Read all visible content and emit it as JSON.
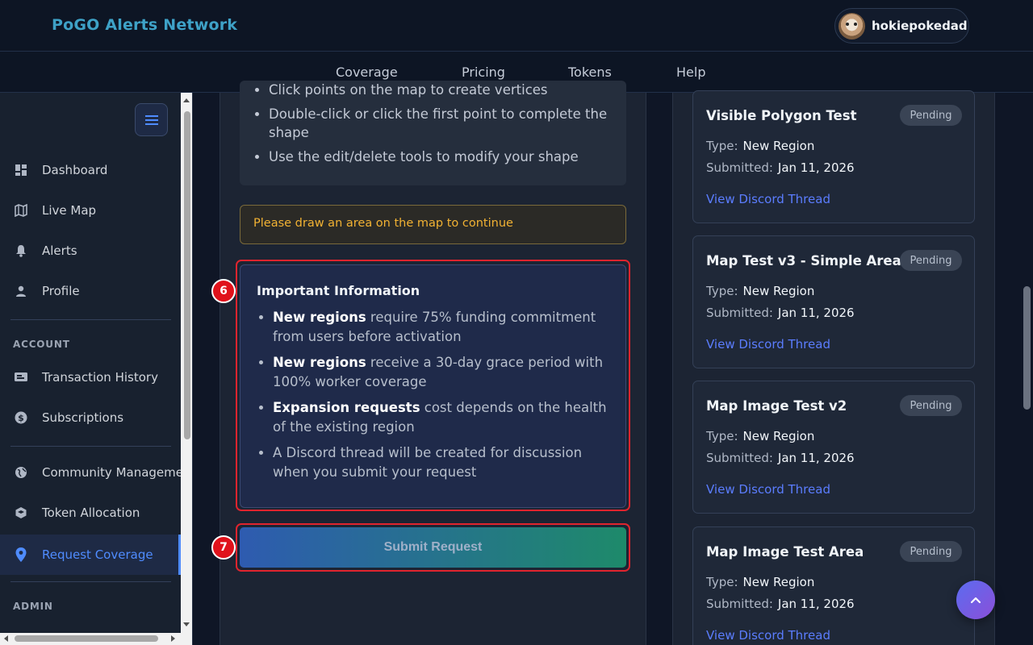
{
  "app": {
    "brand": "PoGO Alerts Network",
    "username": "hokiepokedad"
  },
  "nav": {
    "links": [
      "Coverage",
      "Pricing",
      "Tokens",
      "Help"
    ]
  },
  "sidebar": {
    "items": [
      {
        "label": "Dashboard",
        "icon": "dashboard-icon"
      },
      {
        "label": "Live Map",
        "icon": "map-icon"
      },
      {
        "label": "Alerts",
        "icon": "bell-icon"
      },
      {
        "label": "Profile",
        "icon": "person-icon"
      }
    ],
    "account_header": "ACCOUNT",
    "account_items": [
      {
        "label": "Transaction History",
        "icon": "receipt-icon"
      },
      {
        "label": "Subscriptions",
        "icon": "dollar-icon"
      }
    ],
    "community_items": [
      {
        "label": "Community Management",
        "icon": "globe-icon"
      },
      {
        "label": "Token Allocation",
        "icon": "token-icon"
      },
      {
        "label": "Request Coverage",
        "icon": "pin-icon",
        "active": true
      }
    ],
    "admin_header": "ADMIN"
  },
  "form": {
    "instructions": [
      "Click points on the map to create vertices",
      "Double-click or click the first point to complete the shape",
      "Use the edit/delete tools to modify your shape"
    ],
    "warning": "Please draw an area on the map to continue",
    "info_title": "Important Information",
    "info_items": [
      {
        "bold": "New regions",
        "text": " require 75% funding commitment from users before activation"
      },
      {
        "bold": "New regions",
        "text": " receive a 30-day grace period with 100% worker coverage"
      },
      {
        "bold": "Expansion requests",
        "text": " cost depends on the health of the existing region"
      },
      {
        "bold": "",
        "text": "A Discord thread will be created for discussion when you submit your request"
      }
    ],
    "submit_label": "Submit Request",
    "badge_info": "6",
    "badge_submit": "7"
  },
  "requests": [
    {
      "title": "Visible Polygon Test",
      "status": "Pending",
      "type_label": "Type:",
      "type": "New Region",
      "submitted_label": "Submitted:",
      "submitted": "Jan 11, 2026",
      "link": "View Discord Thread"
    },
    {
      "title": "Map Test v3 - Simple Area",
      "status": "Pending",
      "type_label": "Type:",
      "type": "New Region",
      "submitted_label": "Submitted:",
      "submitted": "Jan 11, 2026",
      "link": "View Discord Thread"
    },
    {
      "title": "Map Image Test v2",
      "status": "Pending",
      "type_label": "Type:",
      "type": "New Region",
      "submitted_label": "Submitted:",
      "submitted": "Jan 11, 2026",
      "link": "View Discord Thread"
    },
    {
      "title": "Map Image Test Area",
      "status": "Pending",
      "type_label": "Type:",
      "type": "New Region",
      "submitted_label": "Submitted:",
      "submitted": "Jan 11, 2026",
      "link": "View Discord Thread"
    }
  ],
  "colors": {
    "accent": "#4f8cff",
    "warning": "#f2b233",
    "highlight": "#e0242e",
    "link": "#5b7dff"
  }
}
